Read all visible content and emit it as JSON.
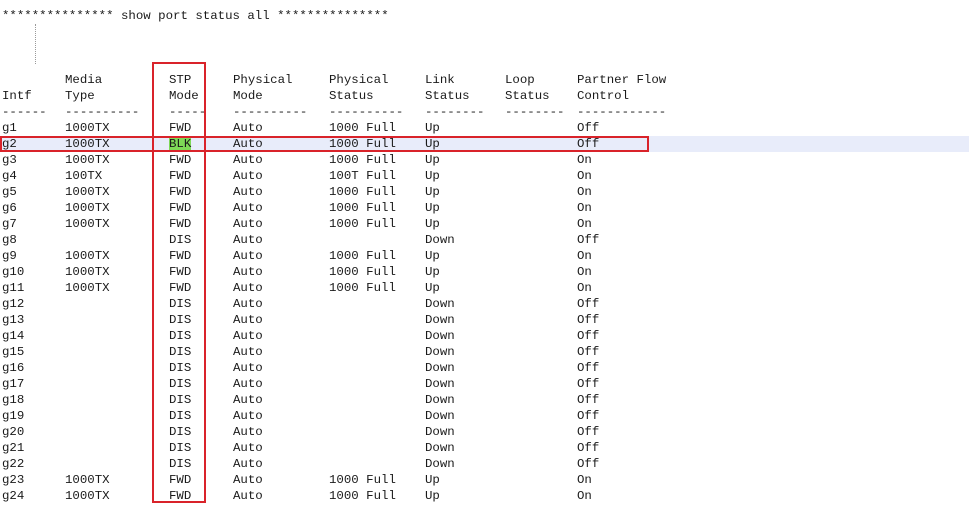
{
  "banner": "*************** show port status all ***************",
  "headers": {
    "line1": {
      "media": "Media",
      "stp": "STP",
      "phys_mode": "Physical",
      "phys_status": "Physical",
      "link": "Link",
      "loop": "Loop",
      "partner": "Partner Flow"
    },
    "line2": {
      "intf": "Intf",
      "media": "Type",
      "stp": "Mode",
      "phys_mode": "Mode",
      "phys_status": "Status",
      "link": "Status",
      "loop": "Status",
      "partner": "Control"
    }
  },
  "dividers": {
    "intf": "------",
    "media": "----------",
    "stp": "-----",
    "phys_mode": "----------",
    "phys_status": "----------",
    "link": "--------",
    "loop": "--------",
    "partner": "------------"
  },
  "selected_port": "g2",
  "rows": [
    {
      "intf": "g1",
      "type": "1000TX",
      "stp": "FWD",
      "mode": "Auto",
      "phys": "1000 Full",
      "link": "Up",
      "loop": "",
      "fc": "Off"
    },
    {
      "intf": "g2",
      "type": "1000TX",
      "stp": "BLK",
      "mode": "Auto",
      "phys": "1000 Full",
      "link": "Up",
      "loop": "",
      "fc": "Off"
    },
    {
      "intf": "g3",
      "type": "1000TX",
      "stp": "FWD",
      "mode": "Auto",
      "phys": "1000 Full",
      "link": "Up",
      "loop": "",
      "fc": "On"
    },
    {
      "intf": "g4",
      "type": "100TX",
      "stp": "FWD",
      "mode": "Auto",
      "phys": "100T Full",
      "link": "Up",
      "loop": "",
      "fc": "On"
    },
    {
      "intf": "g5",
      "type": "1000TX",
      "stp": "FWD",
      "mode": "Auto",
      "phys": "1000 Full",
      "link": "Up",
      "loop": "",
      "fc": "On"
    },
    {
      "intf": "g6",
      "type": "1000TX",
      "stp": "FWD",
      "mode": "Auto",
      "phys": "1000 Full",
      "link": "Up",
      "loop": "",
      "fc": "On"
    },
    {
      "intf": "g7",
      "type": "1000TX",
      "stp": "FWD",
      "mode": "Auto",
      "phys": "1000 Full",
      "link": "Up",
      "loop": "",
      "fc": "On"
    },
    {
      "intf": "g8",
      "type": "",
      "stp": "DIS",
      "mode": "Auto",
      "phys": "",
      "link": "Down",
      "loop": "",
      "fc": "Off"
    },
    {
      "intf": "g9",
      "type": "1000TX",
      "stp": "FWD",
      "mode": "Auto",
      "phys": "1000 Full",
      "link": "Up",
      "loop": "",
      "fc": "On"
    },
    {
      "intf": "g10",
      "type": "1000TX",
      "stp": "FWD",
      "mode": "Auto",
      "phys": "1000 Full",
      "link": "Up",
      "loop": "",
      "fc": "On"
    },
    {
      "intf": "g11",
      "type": "1000TX",
      "stp": "FWD",
      "mode": "Auto",
      "phys": "1000 Full",
      "link": "Up",
      "loop": "",
      "fc": "On"
    },
    {
      "intf": "g12",
      "type": "",
      "stp": "DIS",
      "mode": "Auto",
      "phys": "",
      "link": "Down",
      "loop": "",
      "fc": "Off"
    },
    {
      "intf": "g13",
      "type": "",
      "stp": "DIS",
      "mode": "Auto",
      "phys": "",
      "link": "Down",
      "loop": "",
      "fc": "Off"
    },
    {
      "intf": "g14",
      "type": "",
      "stp": "DIS",
      "mode": "Auto",
      "phys": "",
      "link": "Down",
      "loop": "",
      "fc": "Off"
    },
    {
      "intf": "g15",
      "type": "",
      "stp": "DIS",
      "mode": "Auto",
      "phys": "",
      "link": "Down",
      "loop": "",
      "fc": "Off"
    },
    {
      "intf": "g16",
      "type": "",
      "stp": "DIS",
      "mode": "Auto",
      "phys": "",
      "link": "Down",
      "loop": "",
      "fc": "Off"
    },
    {
      "intf": "g17",
      "type": "",
      "stp": "DIS",
      "mode": "Auto",
      "phys": "",
      "link": "Down",
      "loop": "",
      "fc": "Off"
    },
    {
      "intf": "g18",
      "type": "",
      "stp": "DIS",
      "mode": "Auto",
      "phys": "",
      "link": "Down",
      "loop": "",
      "fc": "Off"
    },
    {
      "intf": "g19",
      "type": "",
      "stp": "DIS",
      "mode": "Auto",
      "phys": "",
      "link": "Down",
      "loop": "",
      "fc": "Off"
    },
    {
      "intf": "g20",
      "type": "",
      "stp": "DIS",
      "mode": "Auto",
      "phys": "",
      "link": "Down",
      "loop": "",
      "fc": "Off"
    },
    {
      "intf": "g21",
      "type": "",
      "stp": "DIS",
      "mode": "Auto",
      "phys": "",
      "link": "Down",
      "loop": "",
      "fc": "Off"
    },
    {
      "intf": "g22",
      "type": "",
      "stp": "DIS",
      "mode": "Auto",
      "phys": "",
      "link": "Down",
      "loop": "",
      "fc": "Off"
    },
    {
      "intf": "g23",
      "type": "1000TX",
      "stp": "FWD",
      "mode": "Auto",
      "phys": "1000 Full",
      "link": "Up",
      "loop": "",
      "fc": "On"
    },
    {
      "intf": "g24",
      "type": "1000TX",
      "stp": "FWD",
      "mode": "Auto",
      "phys": "1000 Full",
      "link": "Up",
      "loop": "",
      "fc": "On"
    }
  ],
  "colors": {
    "annotation_red": "#d9232a",
    "blk_highlight": "#7ed957",
    "selected_row_bg": "#e8ecfa"
  }
}
